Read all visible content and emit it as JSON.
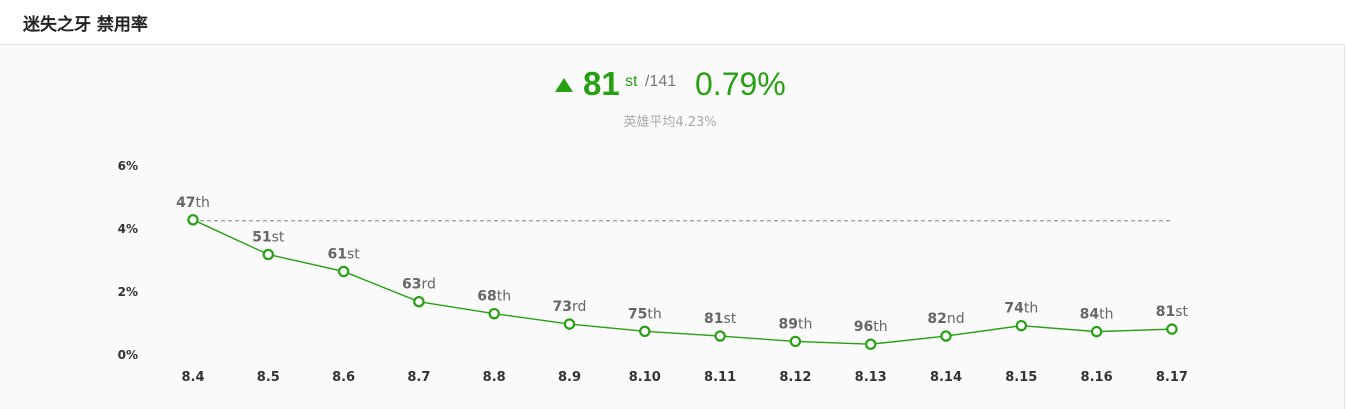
{
  "header": {
    "title": "迷失之牙 禁用率"
  },
  "summary": {
    "rank": "81",
    "rank_suffix": "st",
    "rank_total": "/141",
    "rate": "0.79%",
    "average_label": "英雄平均4.23%",
    "trend": "up"
  },
  "colors": {
    "accent": "#27a012",
    "average_line": "#999999"
  },
  "chart_data": {
    "type": "line",
    "categories": [
      "8.4",
      "8.5",
      "8.6",
      "8.7",
      "8.8",
      "8.9",
      "8.10",
      "8.11",
      "8.12",
      "8.13",
      "8.14",
      "8.15",
      "8.16",
      "8.17"
    ],
    "values": [
      4.26,
      3.16,
      2.62,
      1.66,
      1.28,
      0.95,
      0.72,
      0.57,
      0.4,
      0.31,
      0.57,
      0.9,
      0.71,
      0.79
    ],
    "point_labels": [
      {
        "num": "47",
        "suffix": "th"
      },
      {
        "num": "51",
        "suffix": "st"
      },
      {
        "num": "61",
        "suffix": "st"
      },
      {
        "num": "63",
        "suffix": "rd"
      },
      {
        "num": "68",
        "suffix": "th"
      },
      {
        "num": "73",
        "suffix": "rd"
      },
      {
        "num": "75",
        "suffix": "th"
      },
      {
        "num": "81",
        "suffix": "st"
      },
      {
        "num": "89",
        "suffix": "th"
      },
      {
        "num": "96",
        "suffix": "th"
      },
      {
        "num": "82",
        "suffix": "nd"
      },
      {
        "num": "74",
        "suffix": "th"
      },
      {
        "num": "84",
        "suffix": "th"
      },
      {
        "num": "81",
        "suffix": "st"
      }
    ],
    "average": 4.23,
    "y_ticks": [
      {
        "value": 0,
        "label": "0%"
      },
      {
        "value": 2,
        "label": "2%"
      },
      {
        "value": 4,
        "label": "4%"
      },
      {
        "value": 6,
        "label": "6%"
      }
    ],
    "ylim": [
      0,
      6
    ],
    "grid": false,
    "legend": "none"
  }
}
